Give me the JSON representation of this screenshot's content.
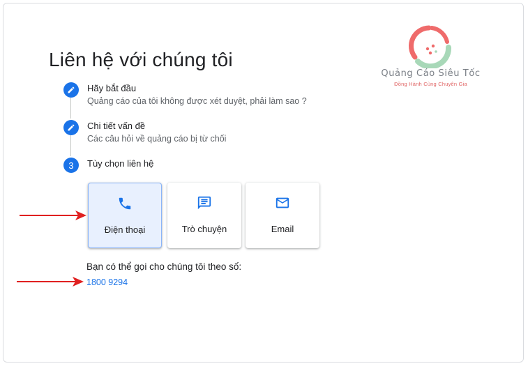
{
  "page_title": "Liên hệ với chúng tôi",
  "logo": {
    "name": "Quảng Cáo Siêu Tốc",
    "tagline": "Đồng Hành Cùng Chuyên Gia"
  },
  "steps": [
    {
      "marker": "edit",
      "title": "Hãy bắt đầu",
      "subtitle": "Quảng cáo của tôi không được xét duyệt, phải làm sao ?"
    },
    {
      "marker": "edit",
      "title": "Chi tiết vấn đề",
      "subtitle": "Các câu hỏi về quảng cáo bị từ chối"
    },
    {
      "marker": "3",
      "title": "Tùy chọn liên hệ"
    }
  ],
  "contact_options": [
    {
      "label": "Điện thoại",
      "icon": "phone-icon",
      "selected": true
    },
    {
      "label": "Trò chuyện",
      "icon": "chat-icon",
      "selected": false
    },
    {
      "label": "Email",
      "icon": "mail-icon",
      "selected": false
    }
  ],
  "call_text": "Bạn có thể gọi cho chúng tôi theo số:",
  "phone_number": "1800 9294",
  "colors": {
    "accent": "#1a73e8",
    "arrow": "#e02020",
    "selected_bg": "#e8f0fe"
  }
}
